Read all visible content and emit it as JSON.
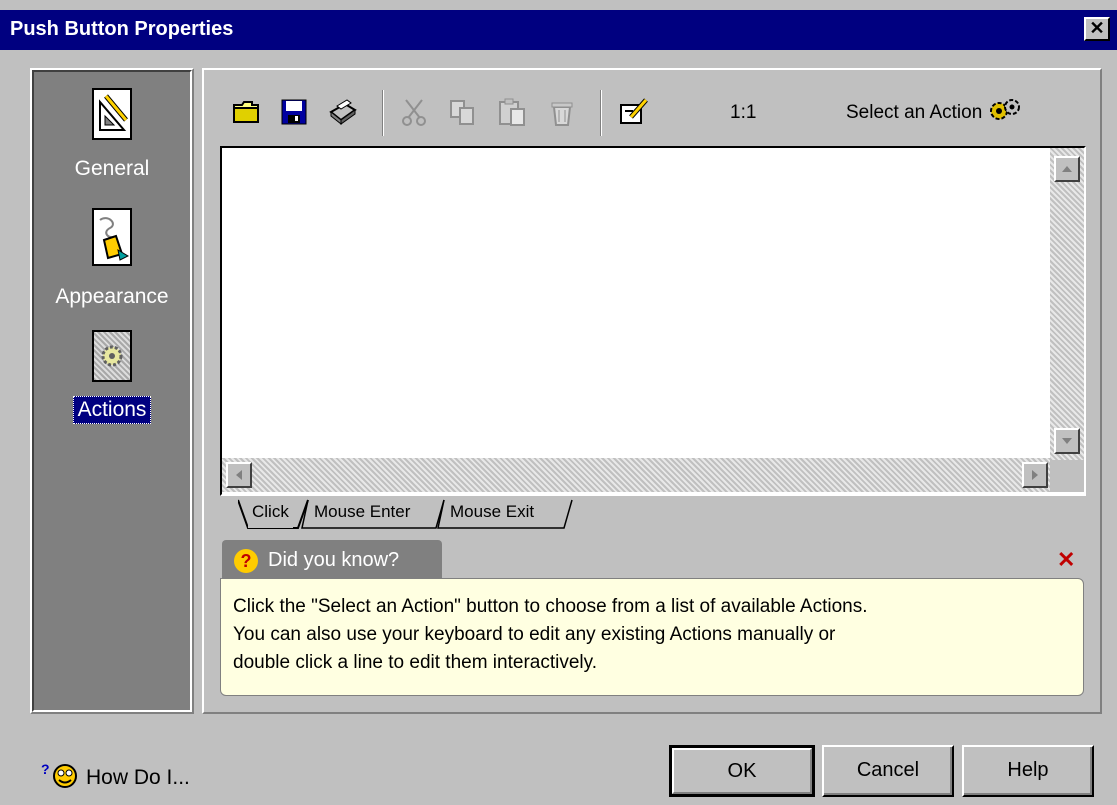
{
  "window": {
    "title": "Push Button Properties",
    "close_glyph": "✕"
  },
  "sidebar": {
    "items": [
      {
        "label": "General",
        "icon": "general-page-icon",
        "selected": false
      },
      {
        "label": "Appearance",
        "icon": "appearance-page-icon",
        "selected": false
      },
      {
        "label": "Actions",
        "icon": "actions-page-icon",
        "selected": true
      }
    ]
  },
  "toolbar": {
    "icons": [
      "open-folder-icon",
      "save-disk-icon",
      "print-icon",
      "cut-icon",
      "copy-icon",
      "paste-icon",
      "delete-icon",
      "edit-properties-icon"
    ],
    "zoom": "1:1",
    "select_action_label": "Select an Action"
  },
  "tabs": [
    {
      "label": "Click",
      "active": true
    },
    {
      "label": "Mouse Enter",
      "active": false
    },
    {
      "label": "Mouse Exit",
      "active": false
    }
  ],
  "did_you_know": {
    "title": "Did you know?",
    "lines": [
      "Click the \"Select an Action\" button to choose from a list of available Actions.",
      "You can also use your keyboard to edit any existing Actions manually or",
      "double click a line to edit them interactively."
    ]
  },
  "footer": {
    "how_do_i": "How Do I...",
    "ok": "OK",
    "cancel": "Cancel",
    "help": "Help"
  },
  "colors": {
    "titlebar": "#000080",
    "dialog": "#c0c0c0",
    "sidebar": "#808080",
    "tip_background": "#ffffe1",
    "close_x": "#c00000"
  }
}
